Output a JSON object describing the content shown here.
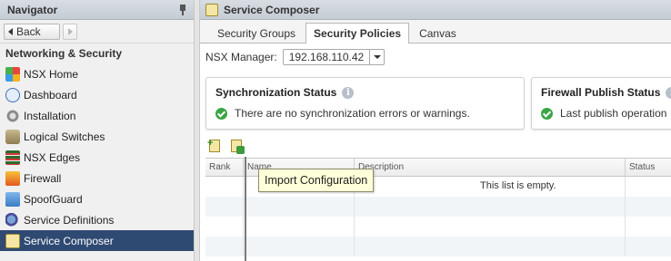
{
  "navigator": {
    "title": "Navigator",
    "back_label": "Back",
    "section_title": "Networking & Security",
    "items": [
      {
        "label": "NSX Home",
        "icon": "nsx-home-icon"
      },
      {
        "label": "Dashboard",
        "icon": "dashboard-icon"
      },
      {
        "label": "Installation",
        "icon": "installation-icon"
      },
      {
        "label": "Logical Switches",
        "icon": "logical-switches-icon"
      },
      {
        "label": "NSX Edges",
        "icon": "nsx-edges-icon"
      },
      {
        "label": "Firewall",
        "icon": "firewall-icon"
      },
      {
        "label": "SpoofGuard",
        "icon": "spoofguard-icon"
      },
      {
        "label": "Service Definitions",
        "icon": "service-definitions-icon"
      },
      {
        "label": "Service Composer",
        "icon": "service-composer-icon",
        "selected": true
      }
    ]
  },
  "main": {
    "title": "Service Composer",
    "tabs": [
      {
        "label": "Security Groups",
        "active": false
      },
      {
        "label": "Security Policies",
        "active": true
      },
      {
        "label": "Canvas",
        "active": false
      }
    ],
    "nsx_manager": {
      "label": "NSX Manager:",
      "value": "192.168.110.42"
    },
    "cards": [
      {
        "title": "Synchronization Status",
        "message": "There are no synchronization errors or warnings."
      },
      {
        "title": "Firewall Publish Status",
        "message": "Last publish operation"
      }
    ],
    "grid": {
      "columns": [
        "Rank",
        "Name",
        "Description",
        "Status"
      ],
      "empty_message": "This list is empty."
    },
    "tooltip": "Import Configuration"
  },
  "colors": {
    "selected_bg": "#2f4a72",
    "ok_green": "#3aa545",
    "header_bg": "#cfd5dc"
  }
}
